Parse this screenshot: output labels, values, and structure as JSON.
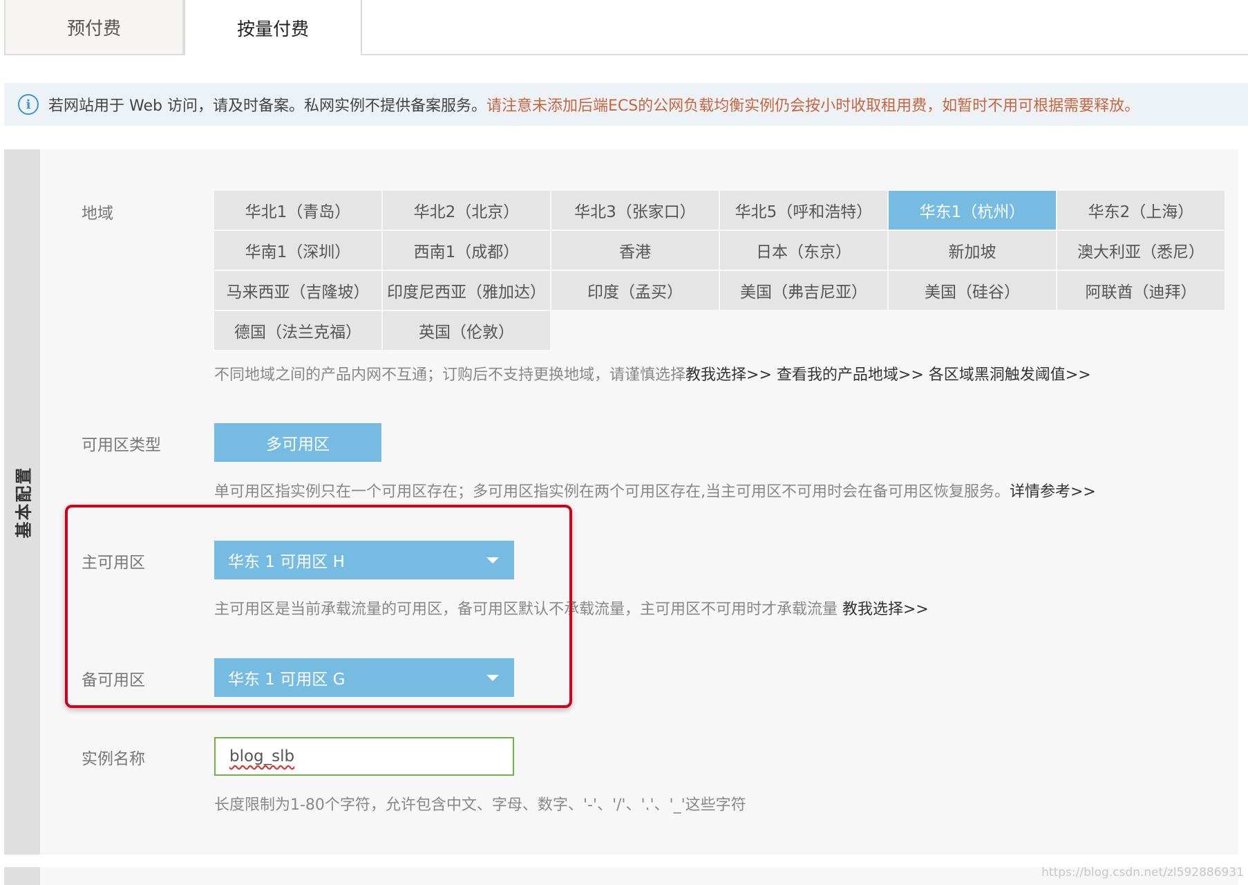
{
  "tabs": [
    {
      "label": "预付费",
      "active": false
    },
    {
      "label": "按量付费",
      "active": true
    }
  ],
  "notice": {
    "icon": "info-icon",
    "text_normal": "若网站用于 Web 访问，请及时备案。私网实例不提供备案服务。",
    "text_warning": "请注意未添加后端ECS的公网负载均衡实例仍会按小时收取租用费，如暂时不用可根据需要释放。",
    "warning_color": "#c9653d"
  },
  "sidebar": {
    "label": "基本配置"
  },
  "region": {
    "label": "地域",
    "options": [
      "华北1（青岛）",
      "华北2（北京）",
      "华北3（张家口）",
      "华北5（呼和浩特）",
      "华东1（杭州）",
      "华东2（上海）",
      "华南1（深圳）",
      "西南1（成都）",
      "香港",
      "日本（东京）",
      "新加坡",
      "澳大利亚（悉尼）",
      "马来西亚（吉隆坡）",
      "印度尼西亚（雅加达）",
      "印度（孟买）",
      "美国（弗吉尼亚）",
      "美国（硅谷）",
      "阿联酋（迪拜）",
      "德国（法兰克福）",
      "英国（伦敦）"
    ],
    "selected": "华东1（杭州）",
    "hint": "不同地域之间的产品内网不互通；订购后不支持更换地域，请谨慎选择",
    "links": [
      "教我选择>>",
      "查看我的产品地域>>",
      "各区域黑洞触发阈值>>"
    ]
  },
  "zone_type": {
    "label": "可用区类型",
    "value": "多可用区",
    "hint": "单可用区指实例只在一个可用区存在；多可用区指实例在两个可用区存在,当主可用区不可用时会在备可用区恢复服务。",
    "link": "详情参考>>"
  },
  "primary_zone": {
    "label": "主可用区",
    "value": "华东 1 可用区 H",
    "hint": "主可用区是当前承载流量的可用区，备可用区默认不承载流量，主可用区不可用时才承载流量 ",
    "link": "教我选择>>"
  },
  "backup_zone": {
    "label": "备可用区",
    "value": "华东 1 可用区 G"
  },
  "instance_name": {
    "label": "实例名称",
    "value": "blog_slb",
    "hint": "长度限制为1-80个字符，允许包含中文、字母、数字、'-'、'/'、'.'、'_'这些字符"
  },
  "watermark": "https://blog.csdn.net/zl592886931",
  "colors": {
    "accent": "#76bce2",
    "highlight_box": "#d0021b",
    "input_border": "#6fb246"
  }
}
